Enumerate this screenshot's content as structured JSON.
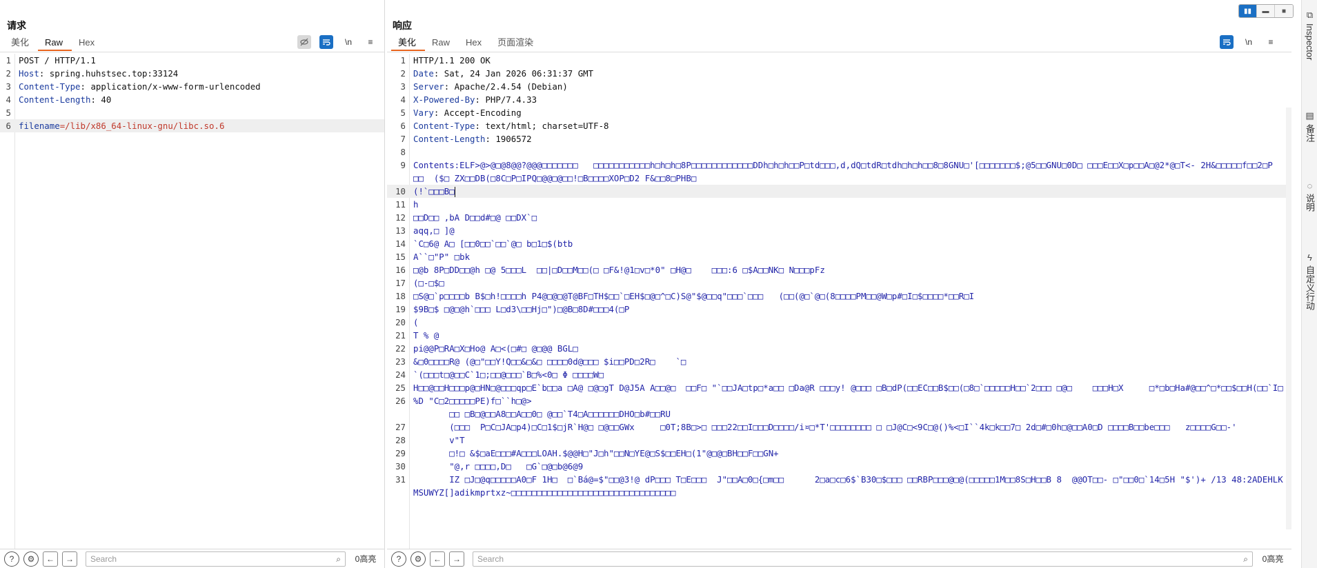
{
  "request": {
    "title": "请求",
    "tabs": [
      {
        "label": "美化",
        "active": false
      },
      {
        "label": "Raw",
        "active": true
      },
      {
        "label": "Hex",
        "active": false
      }
    ],
    "tools": {
      "newline_label": "\\n",
      "menu_label": "≡"
    },
    "lines": [
      {
        "n": "1",
        "key": "",
        "val": "POST / HTTP/1.1"
      },
      {
        "n": "2",
        "key": "Host",
        "val": ": spring.huhstsec.top:33124"
      },
      {
        "n": "3",
        "key": "Content-Type",
        "val": ": application/x-www-form-urlencoded"
      },
      {
        "n": "4",
        "key": "Content-Length",
        "val": ": 40"
      },
      {
        "n": "5",
        "key": "",
        "val": ""
      },
      {
        "n": "6",
        "key": "filename",
        "val": "=/lib/x86_64-linux-gnu/libc.so.6"
      }
    ],
    "search_placeholder": "Search",
    "match_count": "0高亮"
  },
  "response": {
    "title": "响应",
    "tabs": [
      {
        "label": "美化",
        "active": true
      },
      {
        "label": "Raw",
        "active": false
      },
      {
        "label": "Hex",
        "active": false
      },
      {
        "label": "页面渲染",
        "active": false
      }
    ],
    "tools": {
      "newline_label": "\\n",
      "menu_label": "≡"
    },
    "headers": [
      {
        "n": "1",
        "key": "",
        "val": "HTTP/1.1 200 OK"
      },
      {
        "n": "2",
        "key": "Date",
        "val": ": Sat, 24 Jan 2026 06:31:37 GMT"
      },
      {
        "n": "3",
        "key": "Server",
        "val": ": Apache/2.4.54 (Debian)"
      },
      {
        "n": "4",
        "key": "X-Powered-By",
        "val": ": PHP/7.4.33"
      },
      {
        "n": "5",
        "key": "Vary",
        "val": ": Accept-Encoding"
      },
      {
        "n": "6",
        "key": "Content-Type",
        "val": ": text/html; charset=UTF-8"
      },
      {
        "n": "7",
        "key": "Content-Length",
        "val": ": 1906572"
      },
      {
        "n": "8",
        "key": "",
        "val": ""
      }
    ],
    "body": [
      {
        "n": "9",
        "t": "Contents:ELF>@>@□@8@@?@@@□□□□□□□   □□□□□□□□□□□h□h□h□8P□□□□□□□□□□□□DDh□h□h□□P□td□□□,d,dQ□tdR□tdh□h□h□□8□8GNU□'[□□□□□□□$;@5□□GNU□0D□ □□□E□□X□p□□A□@2*@□T<- 2H&□□□□□f□□2□P  □□  ($□ ZX□□DB(□8C□P□IPQ□@@□@□□!□B□□□□XOP□D2 F&□□8□PHB□"
      },
      {
        "n": "10",
        "t": "(!`□□□B□",
        "hl": true
      },
      {
        "n": "11",
        "t": "h"
      },
      {
        "n": "12",
        "t": "□□D□□ ,bA D□□d#□@ □□DX`□"
      },
      {
        "n": "13",
        "t": "aqq,□ ]@"
      },
      {
        "n": "14",
        "t": "`C□6@ A□ [□□0□□`□□`@□ b□1□$(btb"
      },
      {
        "n": "15",
        "t": "A``□\"P\" □bk"
      },
      {
        "n": "16",
        "t": "□@b 8P□DD□□@h □@ 5□□□L  □□|□D□□M□□(□ □F&!@1□v□*0\" □H@□    □□□:6 □$A□□NK□ N□□□pFz"
      },
      {
        "n": "17",
        "t": "(□-□$□"
      },
      {
        "n": "18",
        "t": "□S@□`p□□□□b B$□h!□□□□h P4@□@□@T@BF□TH$□□`□EH$□@□^□C)S@\"$@□□q\"□□□`□□□   (□□(@□`@□(8□□□□PM□□@W□p#□I□$□□□□*□□R□I"
      },
      {
        "n": "19",
        "t": "$9B□$ □@□@h`□□□ L□d3\\□□Hj□\")□@B□8D#□□□4(□P"
      },
      {
        "n": "20",
        "t": "("
      },
      {
        "n": "21",
        "t": "T % @"
      },
      {
        "n": "22",
        "t": "pi@@P□RA□X□Ho@ A□<(□#□ @□@@ BGL□"
      },
      {
        "n": "23",
        "t": "&□0□□□□R@ (@□\"□□Y!Q□□&□&□ □□□□0d@□□□ $i□□PD□2R□    `□"
      },
      {
        "n": "24",
        "t": "`(□□□t□@□□C`1□;□□@□□□`B□%<0□ Φ □□□□W□"
      },
      {
        "n": "25",
        "t": "H□□@□□H□□□p@□HN□@□□□qp□E`b□□a □A@ □@□gT D@J5A A□□@□  □□F□ \"`□□JA□tp□*a□□ □Da@R □□□y! @□□□ □B□dP(□□EC□□B$□□(□8□`□□□□□H□□`2□□□ □@□    □□□H□X     □*□b□Ha#@□□^□*□□$□□H(□□`I□"
      },
      {
        "n": "26",
        "t": "%D \"C□2□□□□□PE)f□``h□@>\n       □□ □B□@□□A8□□A□□0□ @□□`T4□A□□□□□□DHO□b#□□RU"
      },
      {
        "n": "27",
        "t": "       (□□□  P□C□JA□p4)□C□1$□jR`H@□ □@□□GWx     □0T;8B□>□ □□□22□□I□□□D□□□□/i¤□*T'□□□□□□□□ □ □J@C□<9C□@()%<□I``4k□k□□7□ 2d□#□0h□@□□A0□D □□□□B□□be□□□   z□□□□G□□-'"
      },
      {
        "n": "28",
        "t": "       v\"T"
      },
      {
        "n": "29",
        "t": "       □!□ &$□aE□□□#A□□□LOAH.$@@H□\"J□h\"□□N□YE@□S$□□EH□(1\"@□@□BH□□F□□GN+"
      },
      {
        "n": "30",
        "t": "       \"@,r □□□□,D□   □G`□@□b@6@9"
      },
      {
        "n": "31",
        "t": "       IZ □J□@q□□□□□A0□F 1H□  □`Bá@=$\"□□@3!@ dP□□□ T□E□□□  J\"□□A□0□{□m□□      2□a□c□6$`B30□$□□□ □□RBP□□□@□@(□□□□□1M□□8S□H□□B 8  @@OT□□- □\"□□0□`14□5H \"$')+ /13 48:2ADEHLKMSUWYZ[]adikmprtxz~□□□□□□□□□□□□□□□□□□□□□□□□□□□□□□□□"
      }
    ],
    "search_placeholder": "Search",
    "match_count": "0高亮"
  },
  "layout_toggle": {
    "options": [
      "split-horizontal",
      "split-vertical",
      "single"
    ],
    "active": 0
  },
  "side_rail": [
    {
      "icon": "inspector-icon",
      "label": "Inspector"
    },
    {
      "icon": "notes-icon",
      "label": "备注"
    },
    {
      "icon": "explain-icon",
      "label": "说明"
    },
    {
      "icon": "custom-actions-icon",
      "label": "自定义行动"
    }
  ],
  "colors": {
    "accent_tab": "#e8641d",
    "tool_blue": "#1a6fc4",
    "header_key": "#1b3b9e",
    "body_text": "#2124a8"
  }
}
